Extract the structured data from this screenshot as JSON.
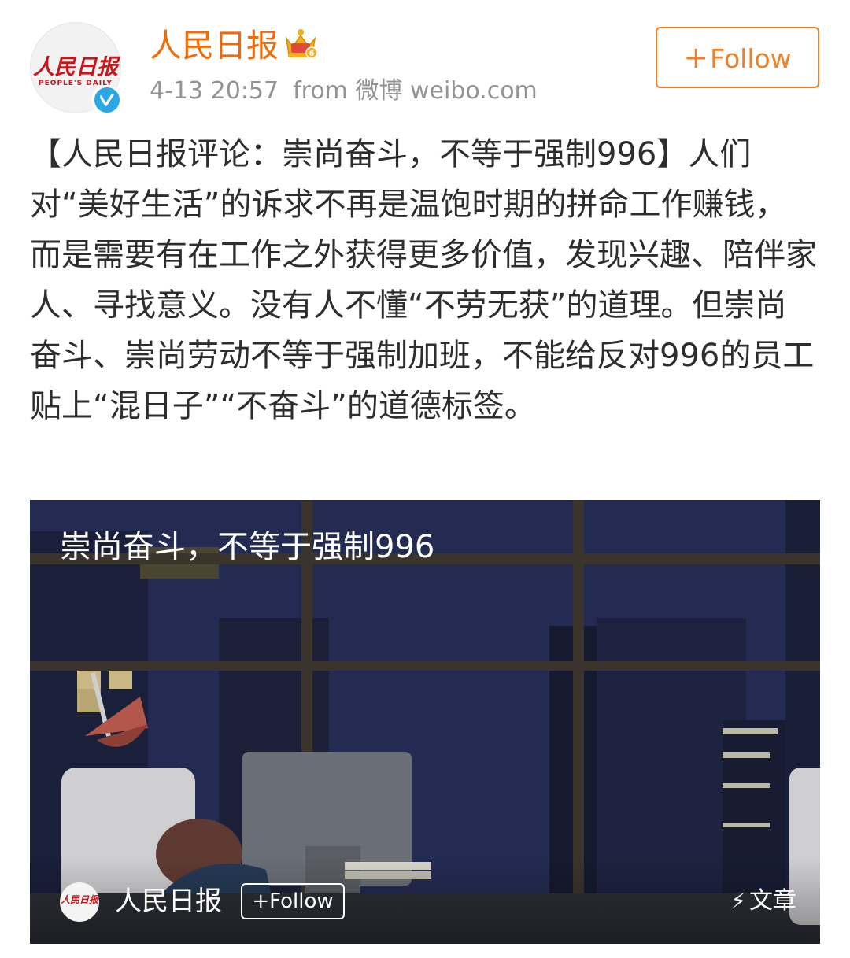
{
  "header": {
    "avatar": {
      "logo_text": "人民日报",
      "logo_sub": "PEOPLE'S DAILY",
      "verified_icon": "verified-badge-icon"
    },
    "username": "人民日报",
    "crown_icon": "crown-member-icon",
    "timestamp": "4-13 20:57",
    "source": "from 微博 weibo.com",
    "follow_label": "Follow",
    "follow_plus": "+"
  },
  "post": {
    "text": "【人民日报评论：崇尚奋斗，不等于强制996】人们对“美好生活”的诉求不再是温饱时期的拼命工作赚钱，而是需要有在工作之外获得更多价值，发现兴趣、陪伴家人、寻找意义。没有人不懂“不劳无获”的道理。但崇尚奋斗、崇尚劳动不等于强制加班，不能给反对996的员工贴上“混日子”“不奋斗”的道德标签。"
  },
  "article_card": {
    "title": "崇尚奋斗，不等于强制996",
    "author": "人民日报",
    "mini_logo_text": "人民日报",
    "follow_label": "+Follow",
    "type_icon": "lightning-icon",
    "type_label": "文章"
  },
  "colors": {
    "accent_orange": "#f07f26",
    "username_orange": "#f06b08",
    "meta_gray": "#939393",
    "text_dark": "#2d2d2d",
    "verified_blue": "#2aa8e6",
    "logo_red": "#c8161d",
    "card_night": "#1e2546"
  }
}
